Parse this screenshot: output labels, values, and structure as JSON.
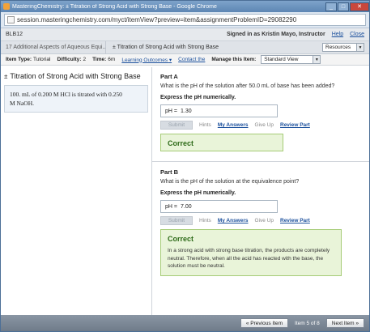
{
  "window": {
    "title": "MasteringChemistry: ± Titration of Strong Acid with Strong Base - Google Chrome",
    "url": "session.masteringchemistry.com/myct/itemView?preview=item&assignmentProblemID=29082290"
  },
  "header": {
    "course": "BLB12",
    "signed_in": "Signed in as Kristin Mayo, Instructor",
    "help": "Help",
    "close": "Close"
  },
  "breadcrumb": {
    "chapter": "17 Additional Aspects of Aqueous Equi...",
    "item": "± Titration of Strong Acid with Strong Base",
    "resources": "Resources"
  },
  "item_info": {
    "type_label": "Item Type:",
    "type_value": "Tutorial",
    "difficulty_label": "Difficulty:",
    "difficulty_value": "2",
    "time_label": "Time:",
    "time_value": "6m",
    "learning_outcomes": "Learning Outcomes",
    "contact": "Contact the",
    "manage_label": "Manage this Item:",
    "view_select": "Standard View"
  },
  "left": {
    "title": "Titration of Strong Acid with Strong Base",
    "mark": "±",
    "stem_line1": "100. mL of 0.200 M HCl is titrated with 0.250",
    "stem_line2": "M NaOH."
  },
  "part_a": {
    "label": "Part A",
    "question": "What is the pH of the solution after 50.0 mL of base has been added?",
    "express": "Express the pH numerically.",
    "answer_label": "pH =",
    "answer_value": "1.30",
    "submit": "Submit",
    "hints": "Hints",
    "my_answers": "My Answers",
    "give_up": "Give Up",
    "review_part": "Review Part",
    "result": "Correct"
  },
  "part_b": {
    "label": "Part B",
    "question": "What is the pH of the solution at the equivalence point?",
    "express": "Express the pH numerically.",
    "answer_label": "pH =",
    "answer_value": "7.00",
    "submit": "Submit",
    "hints": "Hints",
    "my_answers": "My Answers",
    "give_up": "Give Up",
    "review_part": "Review Part",
    "result": "Correct",
    "explanation": "In a strong acid with strong base titration, the products are completely neutral. Therefore, when all the acid has reacted with the base, the solution must be neutral."
  },
  "footer": {
    "prev": "« Previous Item",
    "counter": "Item 5 of 8",
    "next": "Next Item »"
  }
}
